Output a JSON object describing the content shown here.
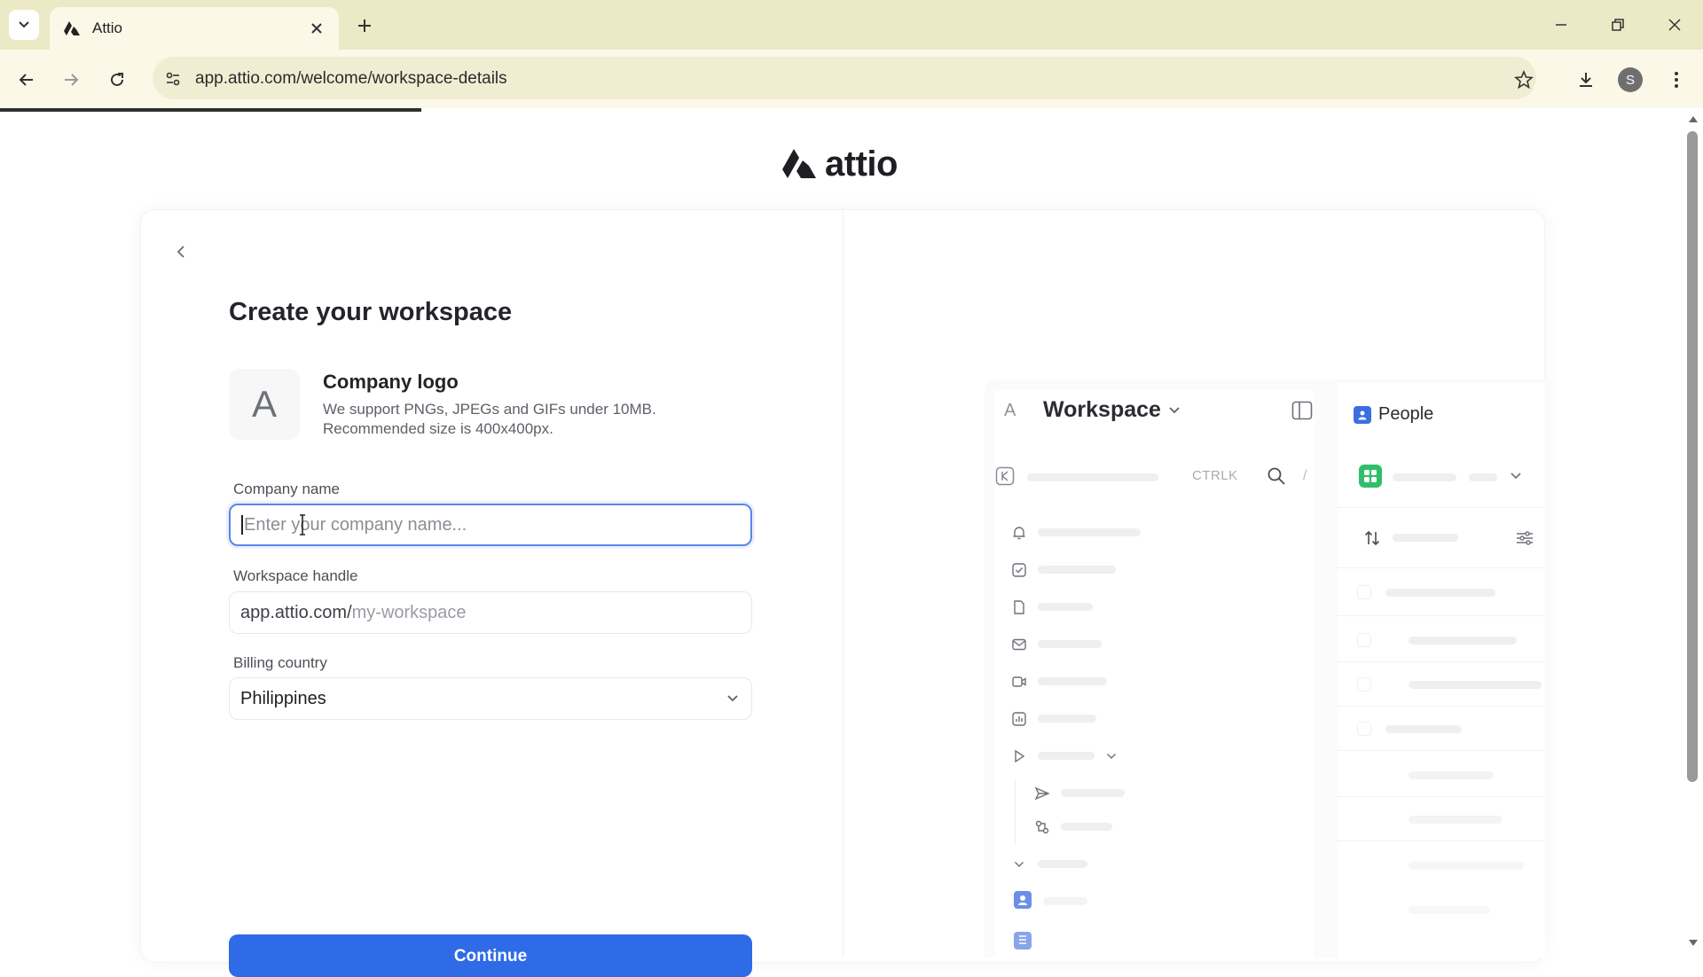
{
  "browser": {
    "tab_title": "Attio",
    "url": "app.attio.com/welcome/workspace-details",
    "profile_initial": "S"
  },
  "brand": {
    "name": "attio"
  },
  "form": {
    "title": "Create your workspace",
    "logo_placeholder_letter": "A",
    "logo_label": "Company logo",
    "logo_help_line1": "We support PNGs, JPEGs and GIFs under 10MB.",
    "logo_help_line2": "Recommended size is 400x400px.",
    "company_name_label": "Company name",
    "company_name_placeholder": "Enter your company name...",
    "company_name_value": "",
    "workspace_handle_label": "Workspace handle",
    "workspace_handle_prefix": "app.attio.com/",
    "workspace_handle_placeholder": "my-workspace",
    "billing_country_label": "Billing country",
    "billing_country_value": "Philippines",
    "continue_label": "Continue"
  },
  "preview": {
    "workspace_letter": "A",
    "workspace_name": "Workspace",
    "shortcut_hint": "CTRLK",
    "slash_hint": "/",
    "object_name": "People"
  },
  "colors": {
    "primary_button": "#2f6be6",
    "focus_ring": "#5a86e8",
    "chrome_tabstrip": "#ece9c6",
    "chrome_toolbar": "#fbf8e8"
  }
}
